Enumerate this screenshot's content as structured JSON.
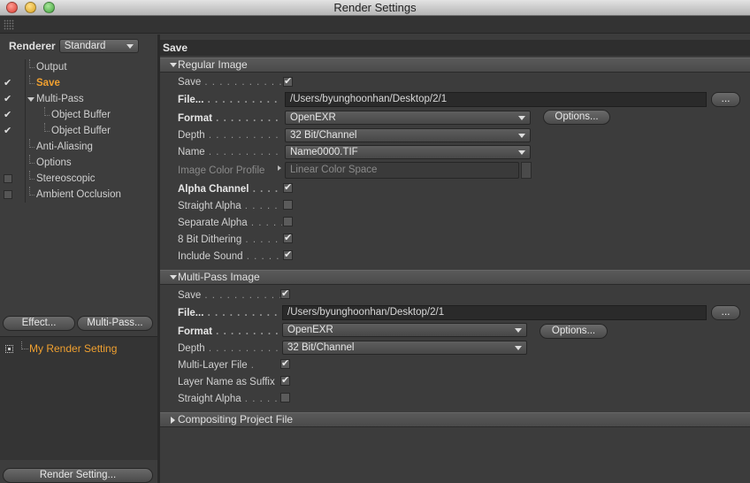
{
  "window": {
    "title": "Render Settings"
  },
  "left": {
    "renderer_label": "Renderer",
    "renderer_value": "Standard",
    "tree": [
      {
        "label": "Output",
        "check": "none"
      },
      {
        "label": "Save",
        "check": "checked",
        "active": true
      },
      {
        "label": "Multi-Pass",
        "check": "checked"
      },
      {
        "label": "Object Buffer",
        "check": "checked"
      },
      {
        "label": "Object Buffer",
        "check": "checked"
      },
      {
        "label": "Anti-Aliasing",
        "check": "none"
      },
      {
        "label": "Options",
        "check": "none"
      },
      {
        "label": "Stereoscopic",
        "check": "unchecked"
      },
      {
        "label": "Ambient Occlusion",
        "check": "unchecked"
      }
    ],
    "effect_button": "Effect...",
    "multipass_button": "Multi-Pass...",
    "setting_name": "My Render Setting",
    "render_setting_button": "Render Setting..."
  },
  "panel": {
    "title": "Save",
    "regular": {
      "header": "Regular Image",
      "save_label": "Save",
      "save_checked": true,
      "file_label": "File...",
      "file_value": "/Users/byunghoonhan/Desktop/2/1",
      "file_browse": "...",
      "format_label": "Format",
      "format_value": "OpenEXR",
      "options_button": "Options...",
      "depth_label": "Depth",
      "depth_value": "32 Bit/Channel",
      "name_label": "Name",
      "name_value": "Name0000.TIF",
      "profile_label": "Image Color Profile",
      "profile_value": "Linear Color Space",
      "alpha_label": "Alpha Channel",
      "alpha_checked": true,
      "straight_label": "Straight Alpha",
      "straight_checked": false,
      "separate_label": "Separate Alpha",
      "separate_checked": false,
      "dither_label": "8 Bit Dithering",
      "dither_checked": true,
      "sound_label": "Include Sound",
      "sound_checked": true
    },
    "multipass": {
      "header": "Multi-Pass Image",
      "save_label": "Save",
      "save_checked": true,
      "file_label": "File...",
      "file_value": "/Users/byunghoonhan/Desktop/2/1",
      "file_browse": "...",
      "format_label": "Format",
      "format_value": "OpenEXR",
      "options_button": "Options...",
      "depth_label": "Depth",
      "depth_value": "32 Bit/Channel",
      "layer_label": "Multi-Layer File",
      "layer_checked": true,
      "suffix_label": "Layer Name as Suffix",
      "suffix_checked": true,
      "straight_label": "Straight Alpha",
      "straight_checked": false
    },
    "compositing_header": "Compositing Project File"
  }
}
